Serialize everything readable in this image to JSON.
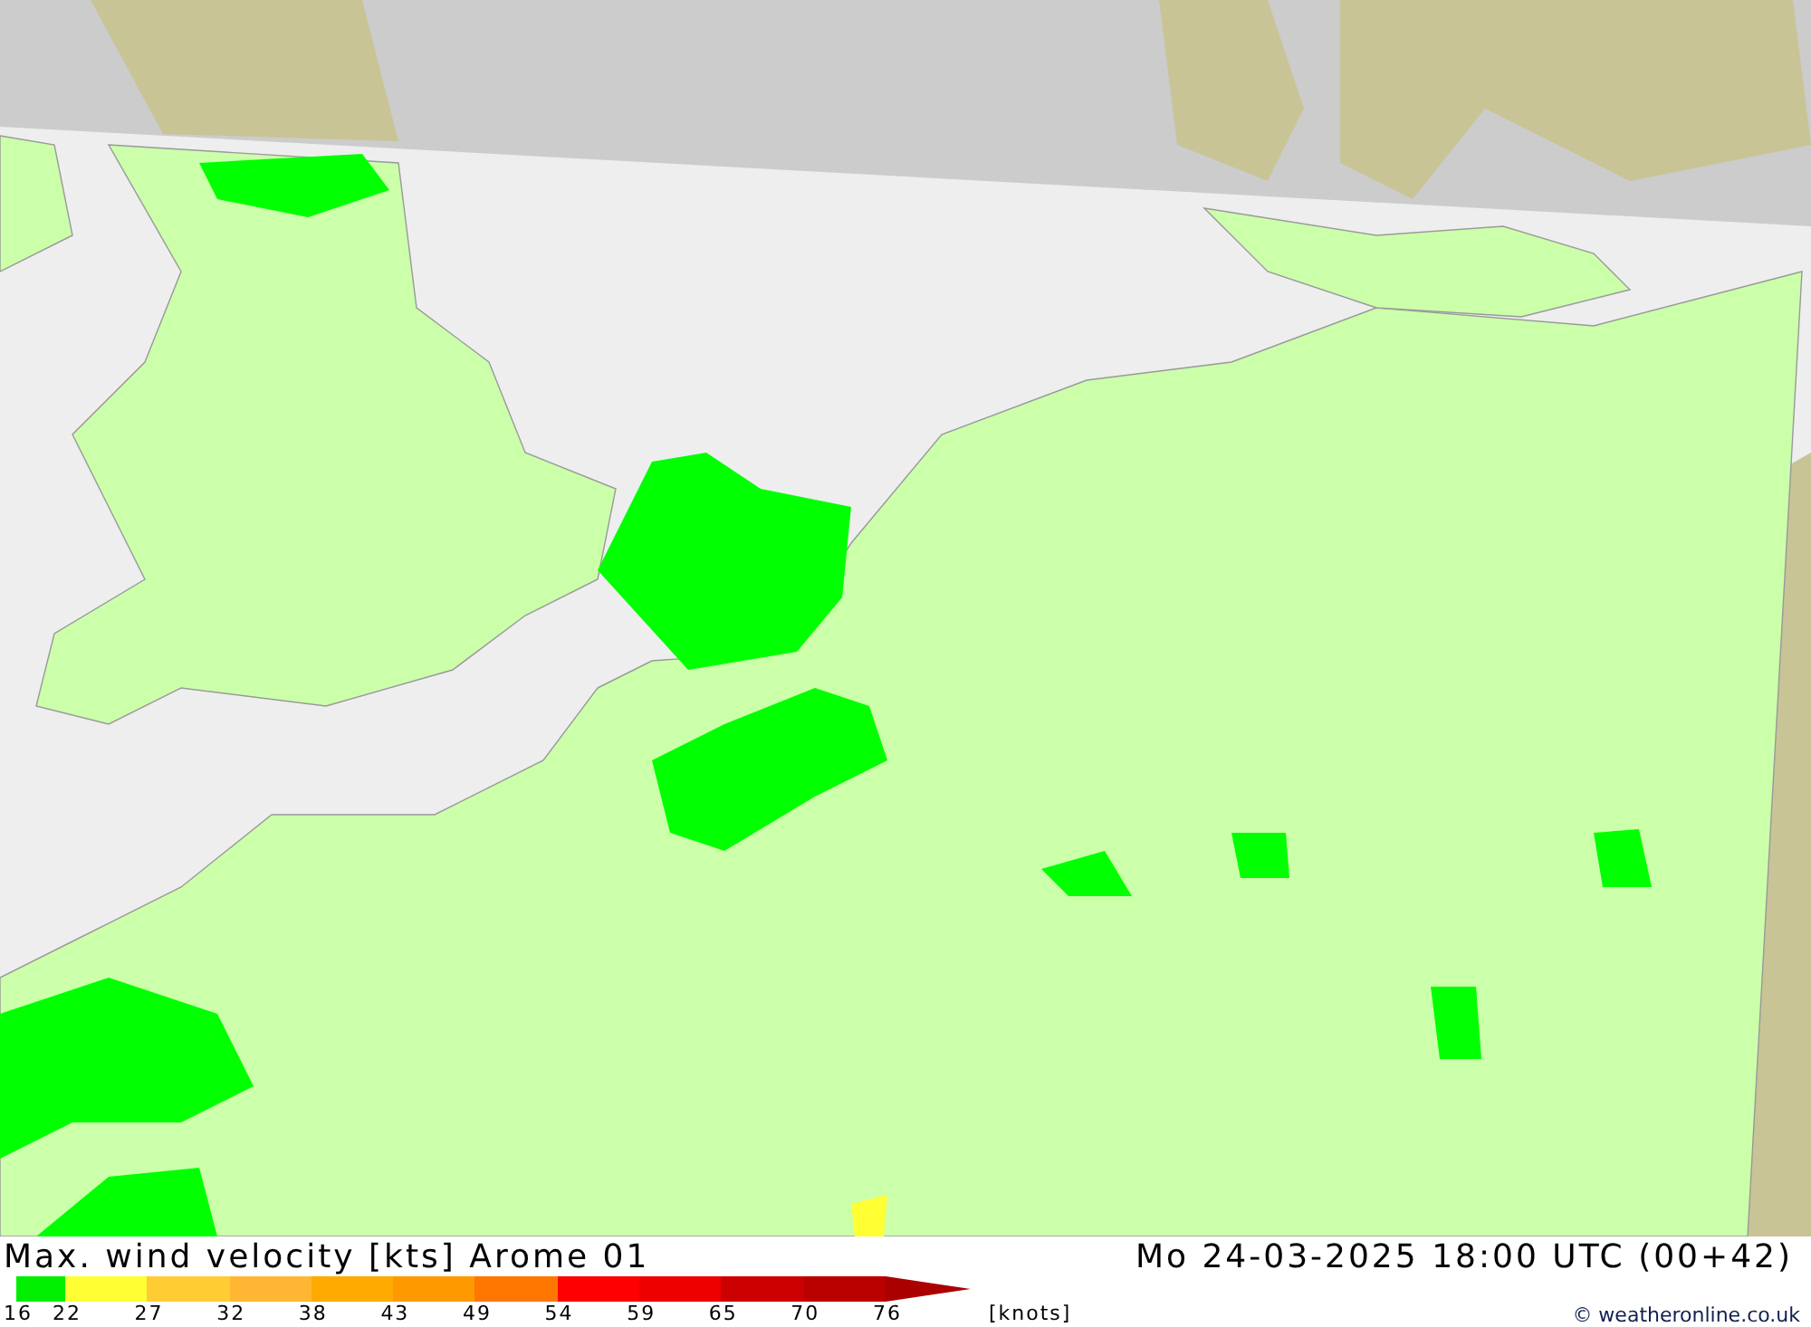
{
  "title": "Max. wind velocity [kts] Arome 01",
  "datetime": "Mo 24-03-2025 18:00 UTC (00+42)",
  "legend": [
    {
      "label": "16",
      "color": "#00ee00"
    },
    {
      "label": "22",
      "color": "#ffff33"
    },
    {
      "label": "27",
      "color": "#ffcc33"
    },
    {
      "label": "32",
      "color": "#ffb733"
    },
    {
      "label": "38",
      "color": "#ffaa00"
    },
    {
      "label": "43",
      "color": "#ff9900"
    },
    {
      "label": "49",
      "color": "#ff7700"
    },
    {
      "label": "54",
      "color": "#ff0000"
    },
    {
      "label": "59",
      "color": "#ee0000"
    },
    {
      "label": "65",
      "color": "#cc0000"
    },
    {
      "label": "70",
      "color": "#bb0000"
    },
    {
      "label": "76",
      "color": "#aa0000"
    }
  ],
  "unit": "[knots]",
  "copyright": "© weatheronline.co.uk"
}
